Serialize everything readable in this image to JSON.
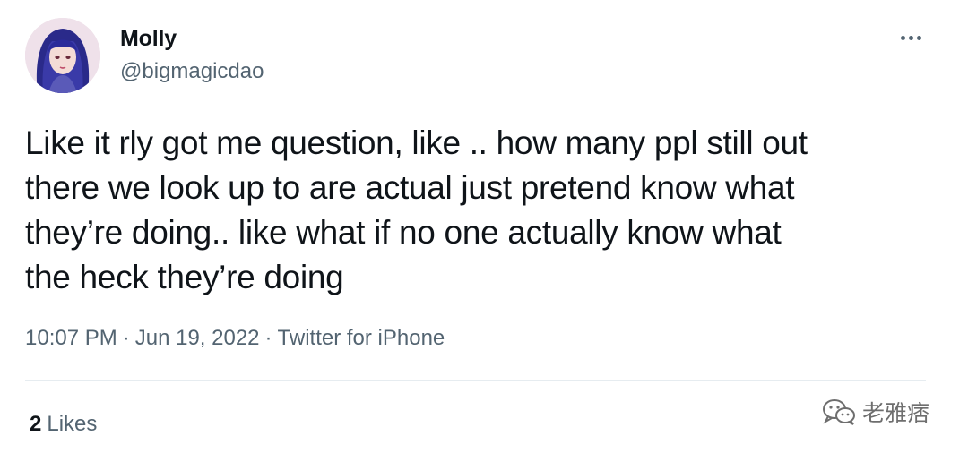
{
  "author": {
    "name": "Molly",
    "handle": "@bigmagicdao",
    "avatar_icon": "avatar-portrait-icon"
  },
  "tweet": {
    "text": "Like it rly got me question, like .. how many ppl still out\nthere we look up to are actual just pretend know what\nthey’re doing.. like what if no one actually know what\nthe heck they’re doing"
  },
  "meta": {
    "time": "10:07 PM",
    "separator": "·",
    "date": "Jun 19, 2022",
    "source": "Twitter for iPhone"
  },
  "stats": {
    "likes_count": "2",
    "likes_label": "Likes"
  },
  "watermark": {
    "icon": "wechat-icon",
    "text": "老雅痞"
  },
  "colors": {
    "text_primary": "#0f1419",
    "text_secondary": "#536471",
    "divider": "#e6ecf0"
  }
}
